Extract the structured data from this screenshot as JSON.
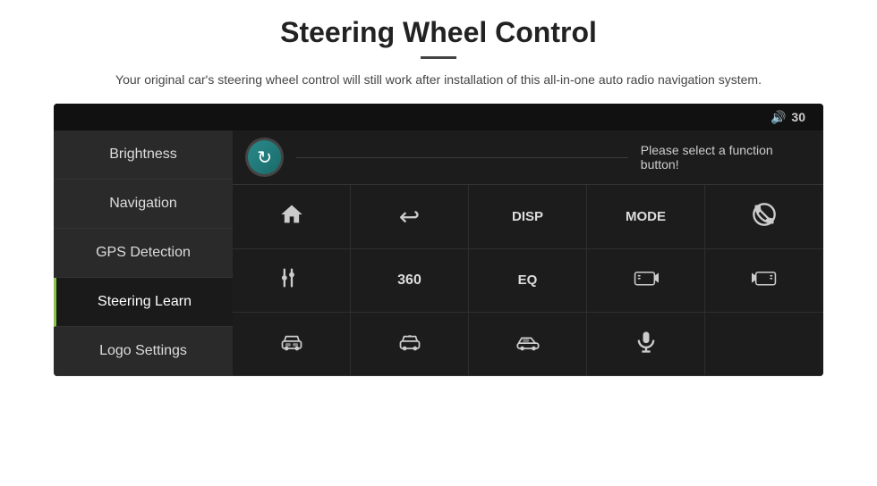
{
  "header": {
    "title": "Steering Wheel Control",
    "divider": true,
    "subtitle": "Your original car's steering wheel control will still work after installation of this all-in-one auto radio navigation system."
  },
  "screen": {
    "volume": {
      "icon": "🔊",
      "level": "30"
    },
    "sidebar": {
      "items": [
        {
          "id": "brightness",
          "label": "Brightness",
          "active": false
        },
        {
          "id": "navigation",
          "label": "Navigation",
          "active": false
        },
        {
          "id": "gps-detection",
          "label": "GPS Detection",
          "active": false
        },
        {
          "id": "steering-learn",
          "label": "Steering Learn",
          "active": true
        },
        {
          "id": "logo-settings",
          "label": "Logo Settings",
          "active": false
        }
      ]
    },
    "main": {
      "function_prompt": "Please select a function button!",
      "refresh_icon": "↻",
      "buttons": [
        {
          "id": "home",
          "icon": "home",
          "label": ""
        },
        {
          "id": "back",
          "icon": "back",
          "label": ""
        },
        {
          "id": "disp",
          "icon": "text",
          "label": "DISP"
        },
        {
          "id": "mode",
          "icon": "text",
          "label": "MODE"
        },
        {
          "id": "phone-cancel",
          "icon": "phone-cancel",
          "label": ""
        },
        {
          "id": "settings",
          "icon": "settings",
          "label": ""
        },
        {
          "id": "360",
          "icon": "text",
          "label": "360"
        },
        {
          "id": "eq",
          "icon": "text",
          "label": "EQ"
        },
        {
          "id": "cam-front",
          "icon": "car-cam",
          "label": ""
        },
        {
          "id": "cam-back",
          "icon": "car-cam2",
          "label": ""
        },
        {
          "id": "car-front",
          "icon": "car-front",
          "label": ""
        },
        {
          "id": "car-360",
          "icon": "car-360",
          "label": ""
        },
        {
          "id": "car-side",
          "icon": "car-side",
          "label": ""
        },
        {
          "id": "mic",
          "icon": "mic",
          "label": ""
        },
        {
          "id": "empty",
          "icon": "",
          "label": ""
        }
      ]
    }
  }
}
